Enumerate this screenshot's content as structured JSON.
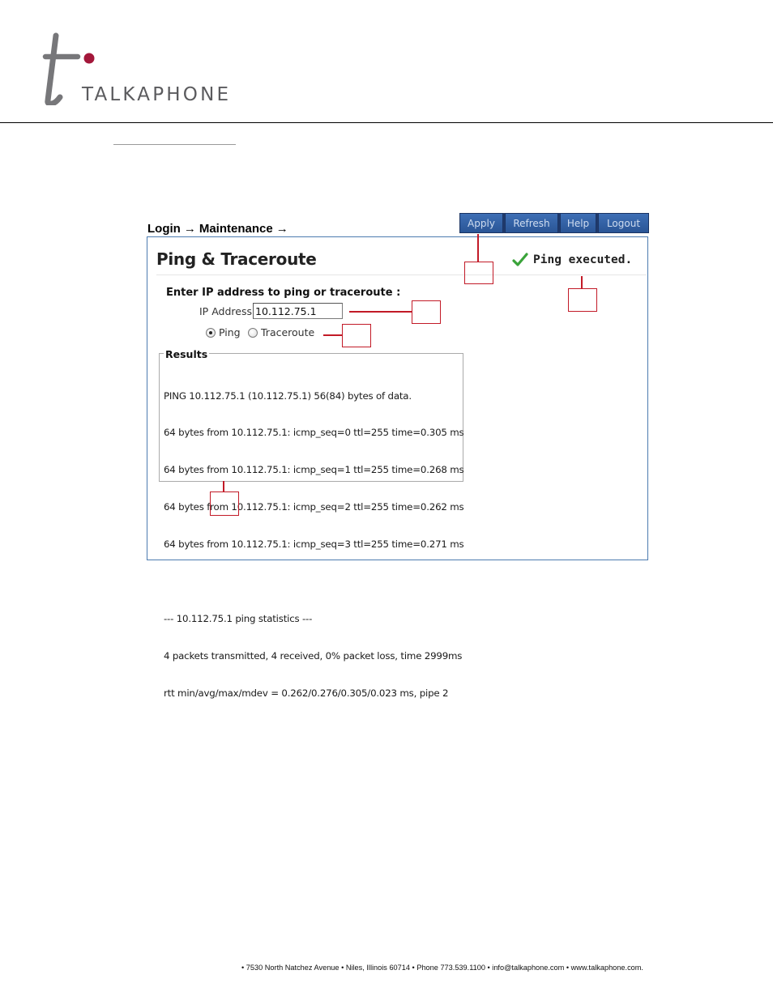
{
  "brand": {
    "name": "TALKAPHONE"
  },
  "breadcrumb": {
    "items": [
      "Login",
      "Maintenance"
    ],
    "arrow": "→"
  },
  "toolbar": {
    "buttons": [
      "Apply",
      "Refresh",
      "Help",
      "Logout"
    ]
  },
  "page": {
    "title": "Ping & Traceroute",
    "status_text": "Ping executed.",
    "form_heading": "Enter IP address to ping or traceroute :",
    "ip_label": "IP Address",
    "ip_value": "10.112.75.1",
    "radios": [
      {
        "label": "Ping",
        "checked": true
      },
      {
        "label": "Traceroute",
        "checked": false
      }
    ]
  },
  "results": {
    "legend": "Results",
    "lines": [
      "PING 10.112.75.1 (10.112.75.1) 56(84) bytes of data.",
      "64 bytes from 10.112.75.1: icmp_seq=0 ttl=255 time=0.305 ms",
      "64 bytes from 10.112.75.1: icmp_seq=1 ttl=255 time=0.268 ms",
      "64 bytes from 10.112.75.1: icmp_seq=2 ttl=255 time=0.262 ms",
      "64 bytes from 10.112.75.1: icmp_seq=3 ttl=255 time=0.271 ms",
      "",
      "--- 10.112.75.1 ping statistics ---",
      "4 packets transmitted, 4 received, 0% packet loss, time 2999ms",
      "rtt min/avg/max/mdev = 0.262/0.276/0.305/0.023 ms, pipe 2"
    ]
  },
  "footer": {
    "text": "• 7530 North Natchez Avenue • Niles, Illinois 60714 • Phone 773.539.1100 • info@talkaphone.com • www.talkaphone.com."
  },
  "colors": {
    "accent_red": "#c21a27",
    "toolbar_blue": "#2a5596",
    "panel_border": "#4c7bb0",
    "check_green": "#3aa33a"
  }
}
